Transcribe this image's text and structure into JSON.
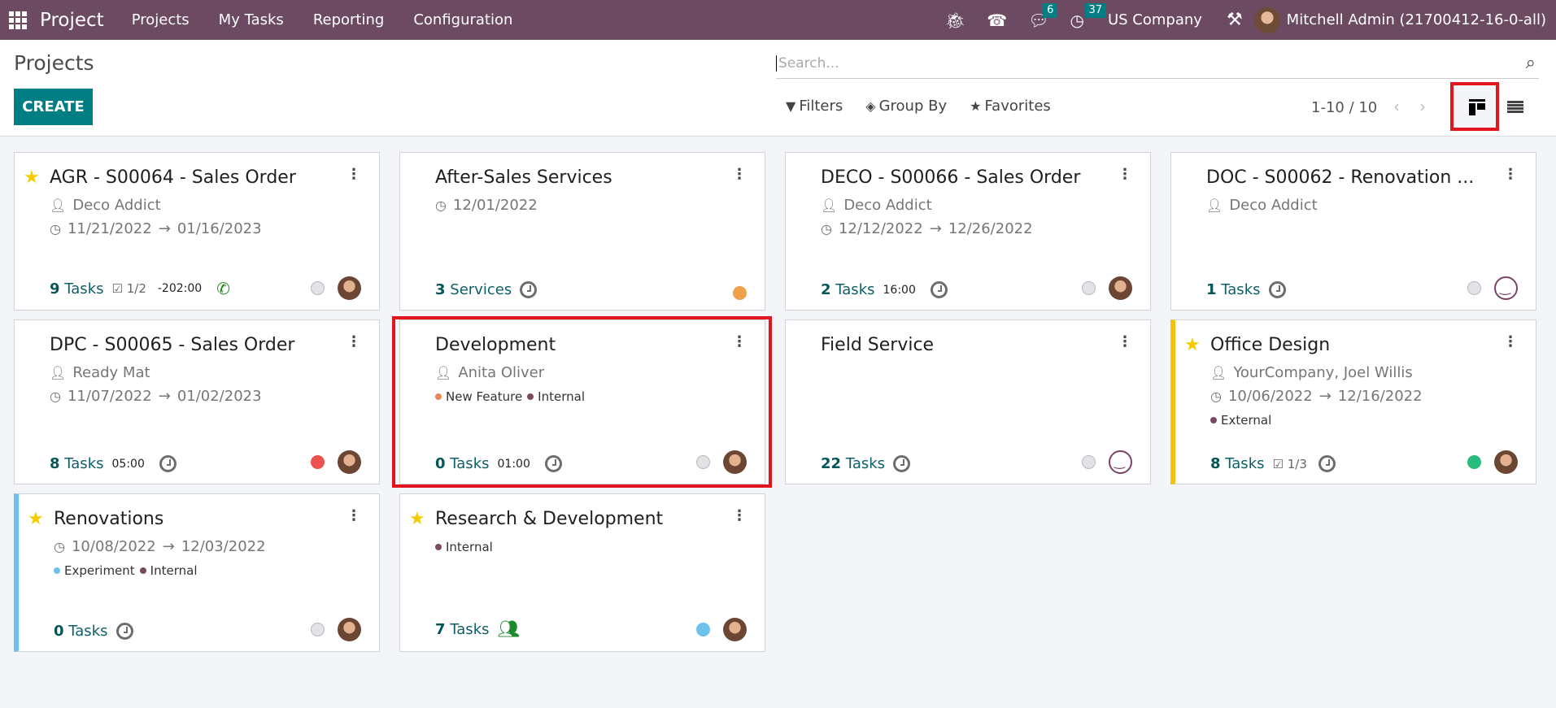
{
  "navbar": {
    "app_name": "Project",
    "menus": [
      "Projects",
      "My Tasks",
      "Reporting",
      "Configuration"
    ],
    "icons": [
      "bug-icon",
      "phone-icon",
      "chat-icon",
      "clock-icon"
    ],
    "messages_count": "6",
    "activities_count": "37",
    "company": "US Company",
    "user": "Mitchell Admin (21700412-16-0-all)"
  },
  "control_panel": {
    "title": "Projects",
    "create_label": "CREATE",
    "search_placeholder": "Search...",
    "filters_label": "Filters",
    "group_by_label": "Group By",
    "favorites_label": "Favorites",
    "pager": "1-10 / 10",
    "active_view": "kanban"
  },
  "colors": {
    "navbar": "#6b4a62",
    "primary": "#017e84",
    "highlight": "#e2141e",
    "star": "#f3cc00"
  },
  "projects": [
    {
      "name": "AGR - S00064 - Sales Order",
      "favorite": true,
      "customer": "Deco Addict",
      "dates": "11/21/2022",
      "date_end": "01/16/2023",
      "tags": [],
      "count": "9",
      "count_label": "Tasks",
      "checklist": "1/2",
      "hours": "-202:00",
      "activity": "phone",
      "status": "grey",
      "avatar": "photo",
      "color": "none"
    },
    {
      "name": "After-Sales Services",
      "favorite": false,
      "customer": "",
      "dates": "12/01/2022",
      "date_end": "",
      "tags": [],
      "count": "3",
      "count_label": "Services",
      "checklist": "",
      "hours": "",
      "activity": "clock",
      "status": "orange",
      "avatar": "",
      "color": "none"
    },
    {
      "name": "DECO - S00066 - Sales Order",
      "favorite": false,
      "customer": "Deco Addict",
      "dates": "12/12/2022",
      "date_end": "12/26/2022",
      "tags": [],
      "count": "2",
      "count_label": "Tasks",
      "checklist": "",
      "hours": "16:00",
      "activity": "clock",
      "status": "grey",
      "avatar": "photo",
      "color": "none"
    },
    {
      "name": "DOC - S00062 - Renovation ...",
      "favorite": false,
      "customer": "Deco Addict",
      "dates": "",
      "date_end": "",
      "tags": [],
      "count": "1",
      "count_label": "Tasks",
      "checklist": "",
      "hours": "",
      "activity": "clock",
      "status": "grey",
      "avatar": "smiley",
      "color": "none"
    },
    {
      "name": "DPC - S00065 - Sales Order",
      "favorite": false,
      "customer": "Ready Mat",
      "dates": "11/07/2022",
      "date_end": "01/02/2023",
      "tags": [],
      "count": "8",
      "count_label": "Tasks",
      "checklist": "",
      "hours": "05:00",
      "activity": "clock",
      "status": "red",
      "avatar": "photo",
      "color": "none"
    },
    {
      "name": "Development",
      "favorite": false,
      "customer": "Anita Oliver",
      "dates": "",
      "date_end": "",
      "tags": [
        {
          "label": "New Feature",
          "color": "#e8875a"
        },
        {
          "label": "Internal",
          "color": "#7b4a62"
        }
      ],
      "count": "0",
      "count_label": "Tasks",
      "checklist": "",
      "hours": "01:00",
      "activity": "clock",
      "status": "grey",
      "avatar": "photo",
      "color": "none",
      "highlighted": true
    },
    {
      "name": "Field Service",
      "favorite": false,
      "customer": "",
      "dates": "",
      "date_end": "",
      "tags": [],
      "count": "22",
      "count_label": "Tasks",
      "checklist": "",
      "hours": "",
      "activity": "clock",
      "status": "grey",
      "avatar": "smiley",
      "color": "none"
    },
    {
      "name": "Office Design",
      "favorite": true,
      "customer": "YourCompany, Joel Willis",
      "dates": "10/06/2022",
      "date_end": "12/16/2022",
      "tags": [
        {
          "label": "External",
          "color": "#7b4a62"
        }
      ],
      "count": "8",
      "count_label": "Tasks",
      "checklist": "1/3",
      "hours": "",
      "activity": "clock",
      "status": "green",
      "avatar": "photo",
      "color": "yellow"
    },
    {
      "name": "Renovations",
      "favorite": true,
      "customer": "",
      "dates": "10/08/2022",
      "date_end": "12/03/2022",
      "tags": [
        {
          "label": "Experiment",
          "color": "#6cc1ed"
        },
        {
          "label": "Internal",
          "color": "#7b4a62"
        }
      ],
      "count": "0",
      "count_label": "Tasks",
      "checklist": "",
      "hours": "",
      "activity": "clock",
      "status": "grey",
      "avatar": "photo",
      "color": "blue"
    },
    {
      "name": "Research & Development",
      "favorite": true,
      "customer": "",
      "dates": "",
      "date_end": "",
      "tags": [
        {
          "label": "Internal",
          "color": "#7b4a62"
        }
      ],
      "count": "7",
      "count_label": "Tasks",
      "checklist": "",
      "hours": "",
      "activity": "users",
      "status": "blue",
      "avatar": "photo",
      "color": "none"
    }
  ]
}
